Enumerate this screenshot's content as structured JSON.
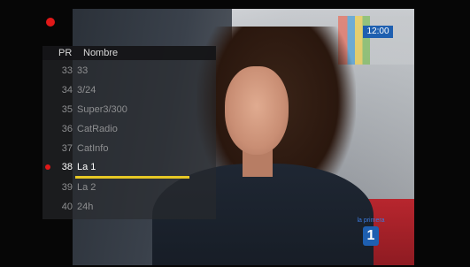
{
  "channel_list": {
    "header": {
      "pr": "PR",
      "name": "Nombre"
    },
    "rows": [
      {
        "number": "33",
        "name": "33"
      },
      {
        "number": "34",
        "name": "3/24"
      },
      {
        "number": "35",
        "name": "Super3/300"
      },
      {
        "number": "36",
        "name": "CatRadio"
      },
      {
        "number": "37",
        "name": "CatInfo"
      },
      {
        "number": "38",
        "name": "La 1",
        "selected": true
      },
      {
        "number": "39",
        "name": "La 2"
      },
      {
        "number": "40",
        "name": "24h"
      }
    ],
    "signal_level": 1.0
  },
  "video": {
    "clock": "12:00",
    "channel_logo_number": "1",
    "channel_logo_text": "la primera"
  },
  "colors": {
    "record_indicator": "#e01818",
    "signal_bar": "#e7c825",
    "logo_blue": "#1e5fb0"
  }
}
